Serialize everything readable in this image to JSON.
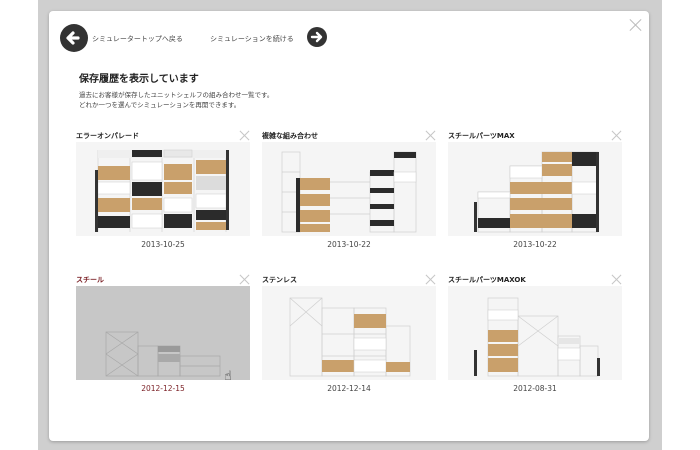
{
  "nav": {
    "back_label": "シミュレータートップへ戻る",
    "continue_label": "シミュレーションを続ける"
  },
  "heading": "保存履歴を表示しています",
  "description": [
    "過去にお客様が保存したユニットシェルフの組み合わせ一覧です。",
    "どれか一つを選んでシミュレーションを再開できます。"
  ],
  "cards": [
    {
      "title": "エラーオンパレード",
      "date": "2013-10-25"
    },
    {
      "title": "複雑な組み合わせ",
      "date": "2013-10-22"
    },
    {
      "title": "スチールパーツMAX",
      "date": "2013-10-22"
    },
    {
      "title": "スチール",
      "date": "2012-12-15",
      "active": true
    },
    {
      "title": "ステンレス",
      "date": "2012-12-14"
    },
    {
      "title": "スチールパーツMAXOK",
      "date": "2012-08-31"
    }
  ],
  "icons": {
    "back": "arrow-left-circle-icon",
    "continue": "arrow-right-circle-icon",
    "close": "close-icon",
    "cursor": "hand-pointer-icon"
  },
  "colors": {
    "accent_active": "#7a1f24",
    "wood": "#c9a06b",
    "dark": "#2b2b2b"
  }
}
